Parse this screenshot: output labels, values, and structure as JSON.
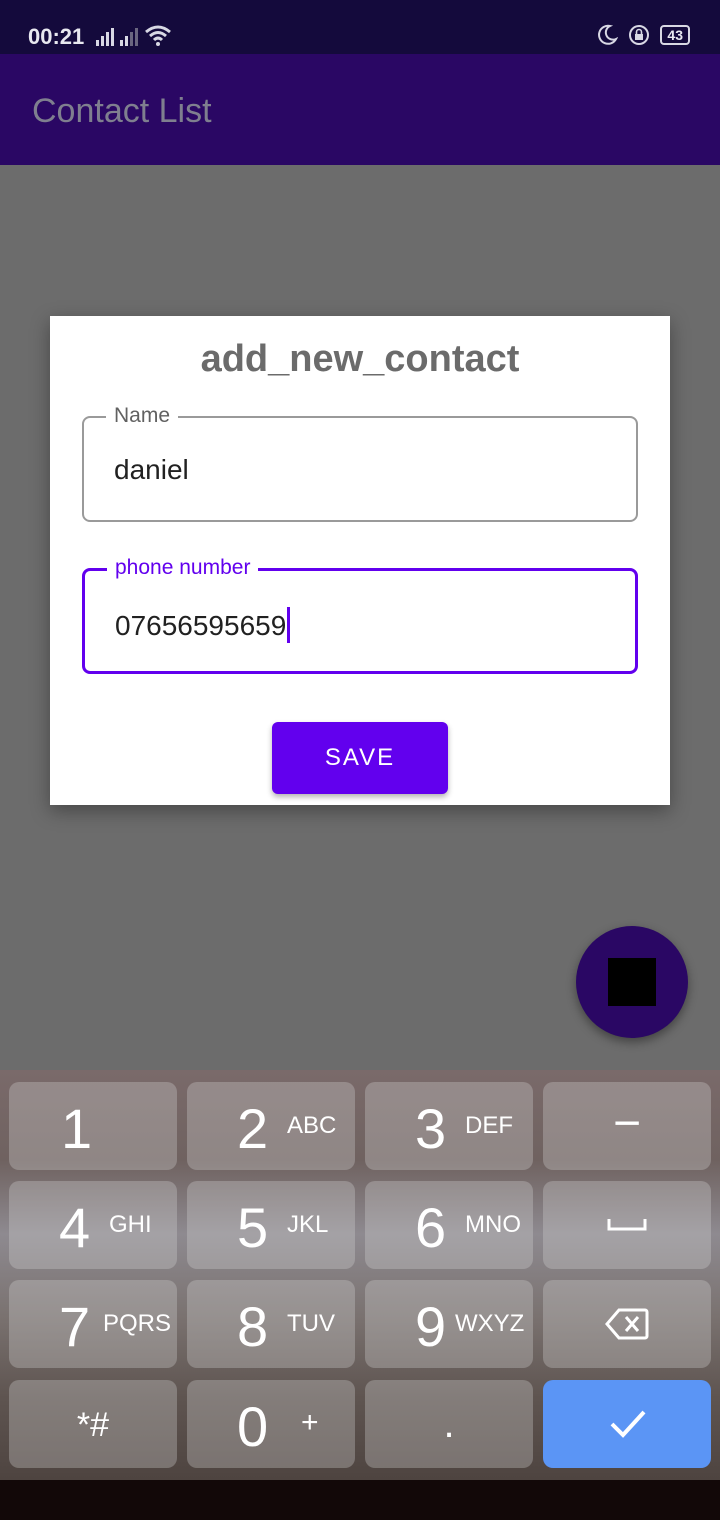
{
  "status": {
    "time": "00:21",
    "battery": "43"
  },
  "app_bar": {
    "title": "Contact List"
  },
  "dialog": {
    "title": "add_new_contact",
    "name_field": {
      "label": "Name",
      "value": "daniel"
    },
    "phone_field": {
      "label": "phone number",
      "value": "07656595659"
    },
    "save_label": "SAVE"
  },
  "keyboard": {
    "keys": [
      {
        "digit": "1",
        "letters": ""
      },
      {
        "digit": "2",
        "letters": "ABC"
      },
      {
        "digit": "3",
        "letters": "DEF"
      },
      {
        "digit": "4",
        "letters": "GHI"
      },
      {
        "digit": "5",
        "letters": "JKL"
      },
      {
        "digit": "6",
        "letters": "MNO"
      },
      {
        "digit": "7",
        "letters": "PQRS"
      },
      {
        "digit": "8",
        "letters": "TUV"
      },
      {
        "digit": "9",
        "letters": "WXYZ"
      },
      {
        "digit": "*#",
        "letters": ""
      },
      {
        "digit": "0",
        "letters": "+"
      },
      {
        "digit": ".",
        "letters": ""
      }
    ],
    "minus": "−",
    "space_icon": "space-icon",
    "backspace_icon": "backspace-icon",
    "done_icon": "check-icon",
    "done_color": "#5b95f5"
  },
  "colors": {
    "primary": "#6200ee",
    "app_bar": "#2a0764"
  }
}
